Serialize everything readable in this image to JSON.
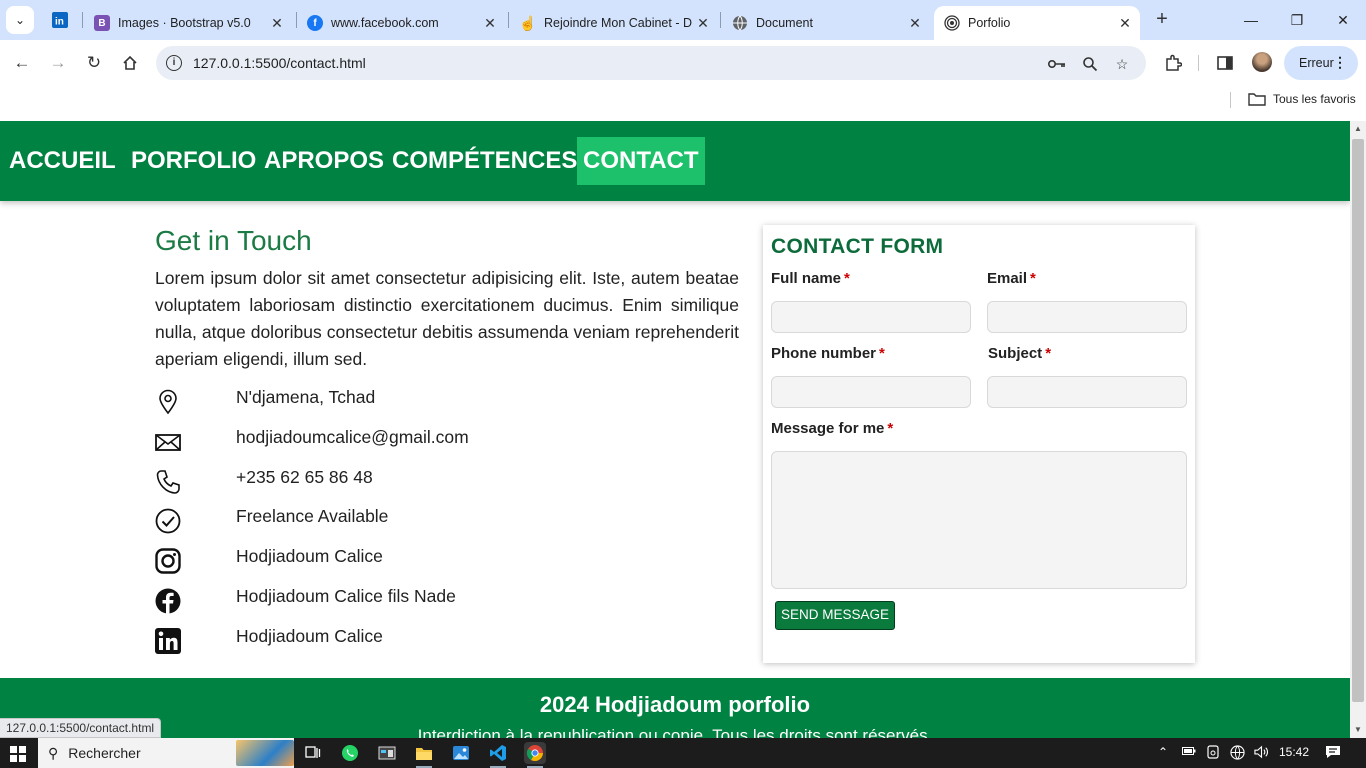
{
  "browser": {
    "tabs": [
      {
        "title": "Images · Bootstrap v5.0",
        "favicon": "bootstrap-icon"
      },
      {
        "title": "www.facebook.com",
        "favicon": "facebook-icon"
      },
      {
        "title": "Rejoindre Mon Cabinet - D",
        "favicon": "hand-icon"
      },
      {
        "title": "Document",
        "favicon": "globe-icon"
      },
      {
        "title": "Porfolio",
        "favicon": "broadcast-icon",
        "active": true
      }
    ],
    "url": "127.0.0.1:5500/contact.html",
    "profile_label": "Erreur",
    "bookmarks_all": "Tous les favoris",
    "status_url": "127.0.0.1:5500/contact.html"
  },
  "nav": {
    "items": [
      {
        "label": "ACCUEIL"
      },
      {
        "label": "PORFOLIO"
      },
      {
        "label": "APROPOS"
      },
      {
        "label": "COMPÉTENCES"
      },
      {
        "label": "CONTACT",
        "active": true
      }
    ]
  },
  "contact": {
    "title": "Get in Touch",
    "text": "Lorem ipsum dolor sit amet consectetur adipisicing elit. Iste, autem beatae voluptatem laboriosam distinctio exercitationem ducimus. Enim similique nulla, atque doloribus consectetur debitis assumenda veniam reprehenderit aperiam eligendi, illum sed.",
    "items": [
      {
        "icon": "location-pin-icon",
        "text": "N'djamena, Tchad"
      },
      {
        "icon": "envelope-icon",
        "text": "hodjiadoumcalice@gmail.com"
      },
      {
        "icon": "phone-icon",
        "text": "+235 62 65 86 48"
      },
      {
        "icon": "check-circle-icon",
        "text": "Freelance Available"
      },
      {
        "icon": "instagram-icon",
        "text": "Hodjiadoum Calice"
      },
      {
        "icon": "facebook-icon",
        "text": "Hodjiadoum Calice fils Nade"
      },
      {
        "icon": "linkedin-icon",
        "text": "Hodjiadoum Calice"
      }
    ]
  },
  "form": {
    "title": "CONTACT FORM",
    "full_name_label": "Full name",
    "email_label": "Email",
    "phone_label": "Phone number",
    "subject_label": "Subject",
    "message_label": "Message for me",
    "required_mark": "*",
    "submit_label": "SEND MESSAGE"
  },
  "footer": {
    "title": "2024 Hodjiadoum porfolio",
    "subtitle": "Interdiction à la republication ou copie. Tous les droits sont réservés."
  },
  "taskbar": {
    "search_label": "Rechercher",
    "time": "15:42"
  },
  "colors": {
    "nav_bg": "#008242",
    "nav_active": "#1ec16b",
    "heading": "#1c7a45",
    "required": "#cc0000"
  }
}
